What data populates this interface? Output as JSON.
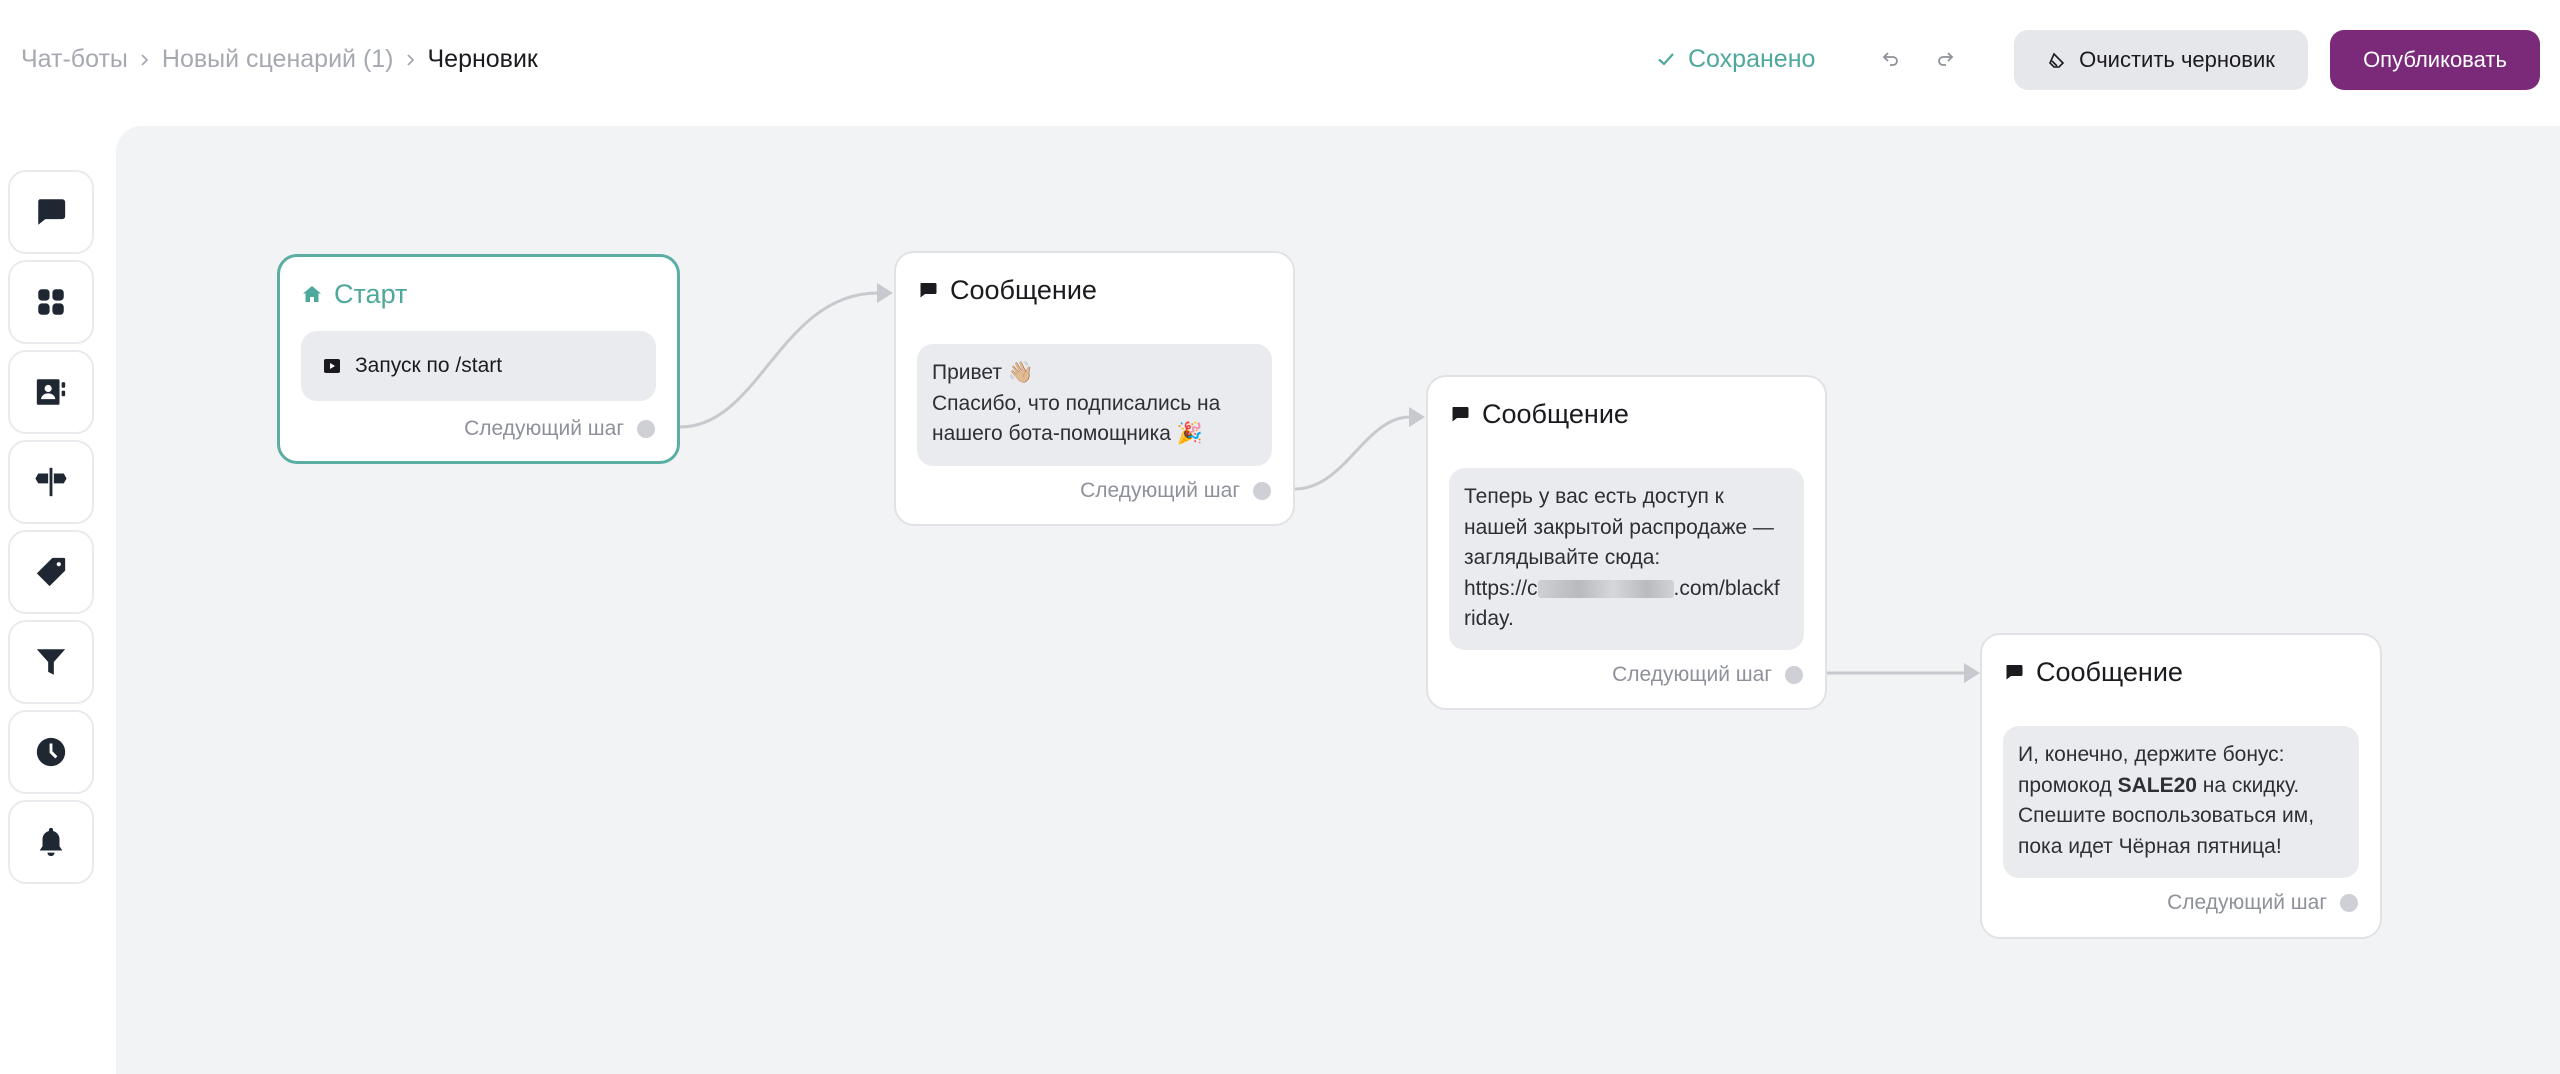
{
  "breadcrumb": {
    "items": [
      "Чат-боты",
      "Новый сценарий (1)",
      "Черновик"
    ]
  },
  "status": {
    "saved_label": "Сохранено",
    "saved_color": "#4fa89c"
  },
  "actions": {
    "clear_label": "Очистить черновик",
    "publish_label": "Опубликовать",
    "publish_color": "#7b2a7a"
  },
  "toolbar": {
    "tools": [
      "message-icon",
      "apps-icon",
      "contact-card-icon",
      "split-icon",
      "tag-icon",
      "filter-icon",
      "clock-icon",
      "bell-icon"
    ]
  },
  "flow": {
    "start": {
      "title": "Старт",
      "trigger": "Запуск по /start",
      "next": "Следующий шаг"
    },
    "messages": [
      {
        "title": "Сообщение",
        "lines": [
          "Привет 👋🏼",
          "Спасибо, что подписались на",
          "нашего бота-помощника 🎉"
        ],
        "next": "Следующий шаг"
      },
      {
        "title": "Сообщение",
        "lines": [
          "Теперь у вас есть доступ к",
          "нашей закрытой распродаже —",
          "заглядывайте сюда:"
        ],
        "link_start": "https://c",
        "link_end": ".com/blackf",
        "link_tail": "riday.",
        "next": "Следующий шаг"
      },
      {
        "title": "Сообщение",
        "line1": "И, конечно, держите бонус:",
        "line2_before": "промокод ",
        "promo_code": "SALE20",
        "line2_after": " на скидку.",
        "line3": "Спешите воспользоваться им,",
        "line4": "пока идет Чёрная пятница!",
        "next": "Следующий шаг"
      }
    ]
  }
}
